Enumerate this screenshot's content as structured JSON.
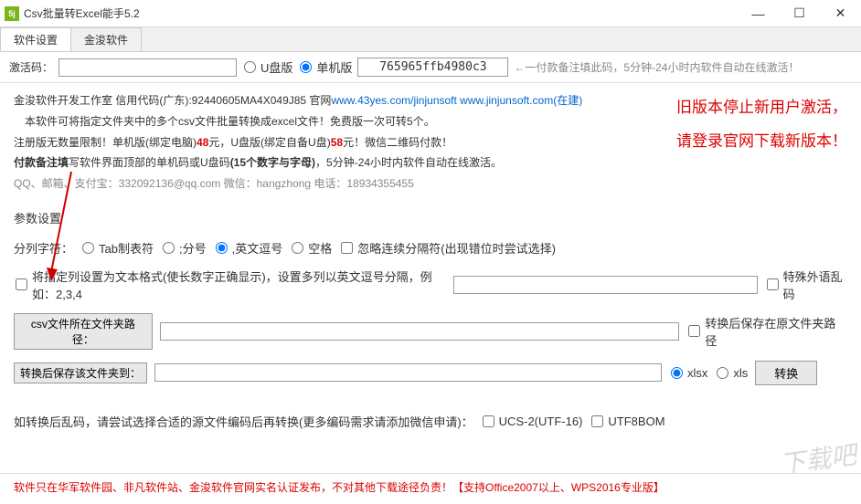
{
  "window": {
    "title": "Csv批量转Excel能手5.2",
    "icon_text": "5j"
  },
  "tabs": {
    "t1": "软件设置",
    "t2": "金浚软件"
  },
  "activation": {
    "label": "激活码：",
    "code_value": "",
    "opt_usb": "U盘版",
    "opt_standalone": "单机版",
    "code_display": "765965ffb4980c3",
    "hint": "←一付款备注填此码，5分钟-24小时内软件自动在线激活！"
  },
  "info": {
    "l1a": "金浚软件开发工作室 信用代码(广东):92440605MA4X049J85 官网",
    "l1b": "www.43yes.com/jinjunsoft   www.jinjunsoft.com(在建)",
    "l2": "本软件可将指定文件夹中的多个csv文件批量转换成excel文件！免费版一次可转5个。",
    "l3a": "注册版无数",
    "l3b": "量限",
    "l3c": "制！单机版(绑定电脑)",
    "l3d": "48",
    "l3e": "元，U盘版(绑定自备U盘)",
    "l3f": "58",
    "l3g": "元！微信二维码付款！",
    "l4a": "付款备注填",
    "l4b": "写软件界面顶部的单机码或U盘码",
    "l4c": "(15个数字与字母)",
    "l4d": "，5分钟-24小时内软件自动在线激活。",
    "l5a": "QQ、邮箱、支付宝：",
    "l5b": "332092136@qq.com",
    "l5c": "   微信：",
    "l5d": "hangzhong",
    "l5e": "   电话：",
    "l5f": "18934355455"
  },
  "notice": {
    "n1": "旧版本停止新用户激活，",
    "n2": "请登录官网下载新版本！"
  },
  "params": {
    "section_label": "参数设置",
    "split_label": "分列字符：",
    "opt_tab": "Tab制表符",
    "opt_semi": ";分号",
    "opt_comma": ",英文逗号",
    "opt_space": "空格",
    "chk_ignore": "忽略连续分隔符(出现错位时尝试选择)",
    "chk_text_format": "将指定列设置为文本格式(使长数字正确显示)，设置多列以英文逗号分隔，例如：2,3,4",
    "text_col_value": "",
    "chk_special": "特殊外语乱码",
    "path_src_btn": "csv文件所在文件夹路径：",
    "path_src_value": "",
    "chk_same_path": "转换后保存在原文件夹路径",
    "path_dst_btn": "转换后保存该文件夹到：",
    "path_dst_value": "",
    "opt_xlsx": "xlsx",
    "opt_xls": "xls",
    "convert_btn": "转换",
    "garbled_text": "如转换后乱码，请尝试选择合适的源文件编码后再转换(更多编码需求请添加微信申请)：",
    "chk_ucs2": "UCS-2(UTF-16)",
    "chk_utf8bom": "UTF8BOM"
  },
  "footer": "软件只在华军软件园、非凡软件站、金浚软件官网实名认证发布，不对其他下载途径负责！【支持Office2007以上、WPS2016专业版】",
  "watermark": "下载吧"
}
